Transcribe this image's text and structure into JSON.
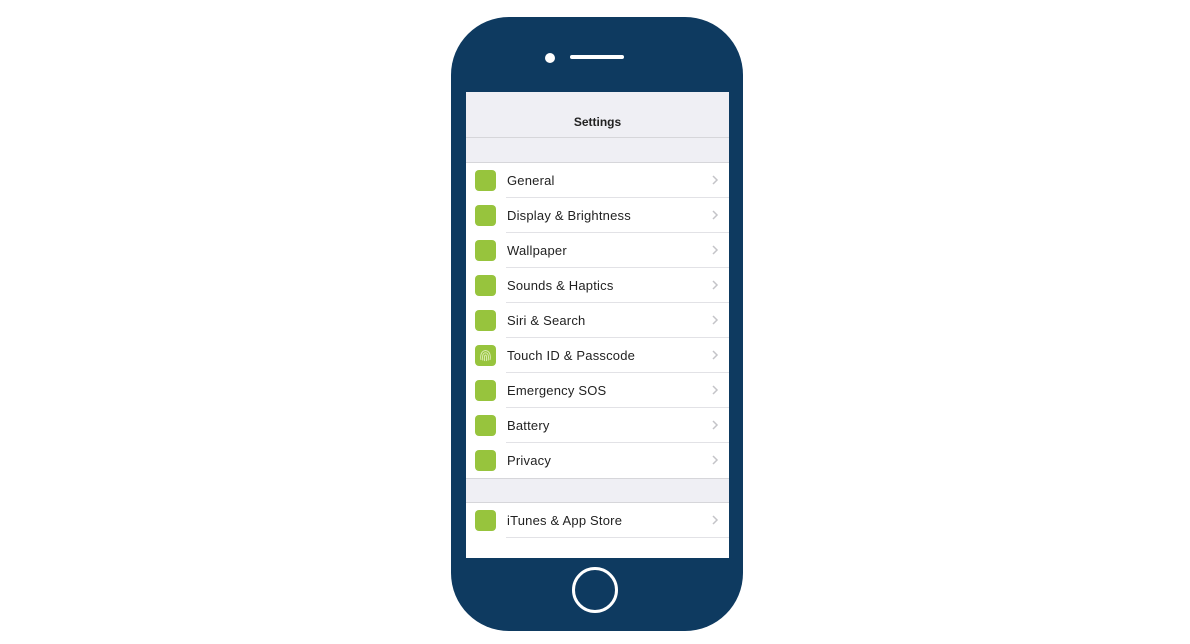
{
  "screen": {
    "title": "Settings"
  },
  "colors": {
    "phone_body": "#0e3a60",
    "icon_green": "#97c43d",
    "background_gray": "#efeff4"
  },
  "groups": [
    {
      "items": [
        {
          "label": "General",
          "icon": "settings-square-icon"
        },
        {
          "label": "Display & Brightness",
          "icon": "settings-square-icon"
        },
        {
          "label": "Wallpaper",
          "icon": "settings-square-icon"
        },
        {
          "label": "Sounds & Haptics",
          "icon": "settings-square-icon"
        },
        {
          "label": "Siri & Search",
          "icon": "settings-square-icon"
        },
        {
          "label": "Touch ID & Passcode",
          "icon": "fingerprint-icon"
        },
        {
          "label": "Emergency SOS",
          "icon": "settings-square-icon"
        },
        {
          "label": "Battery",
          "icon": "settings-square-icon"
        },
        {
          "label": "Privacy",
          "icon": "settings-square-icon"
        }
      ]
    },
    {
      "items": [
        {
          "label": "iTunes & App Store",
          "icon": "settings-square-icon"
        }
      ]
    }
  ]
}
